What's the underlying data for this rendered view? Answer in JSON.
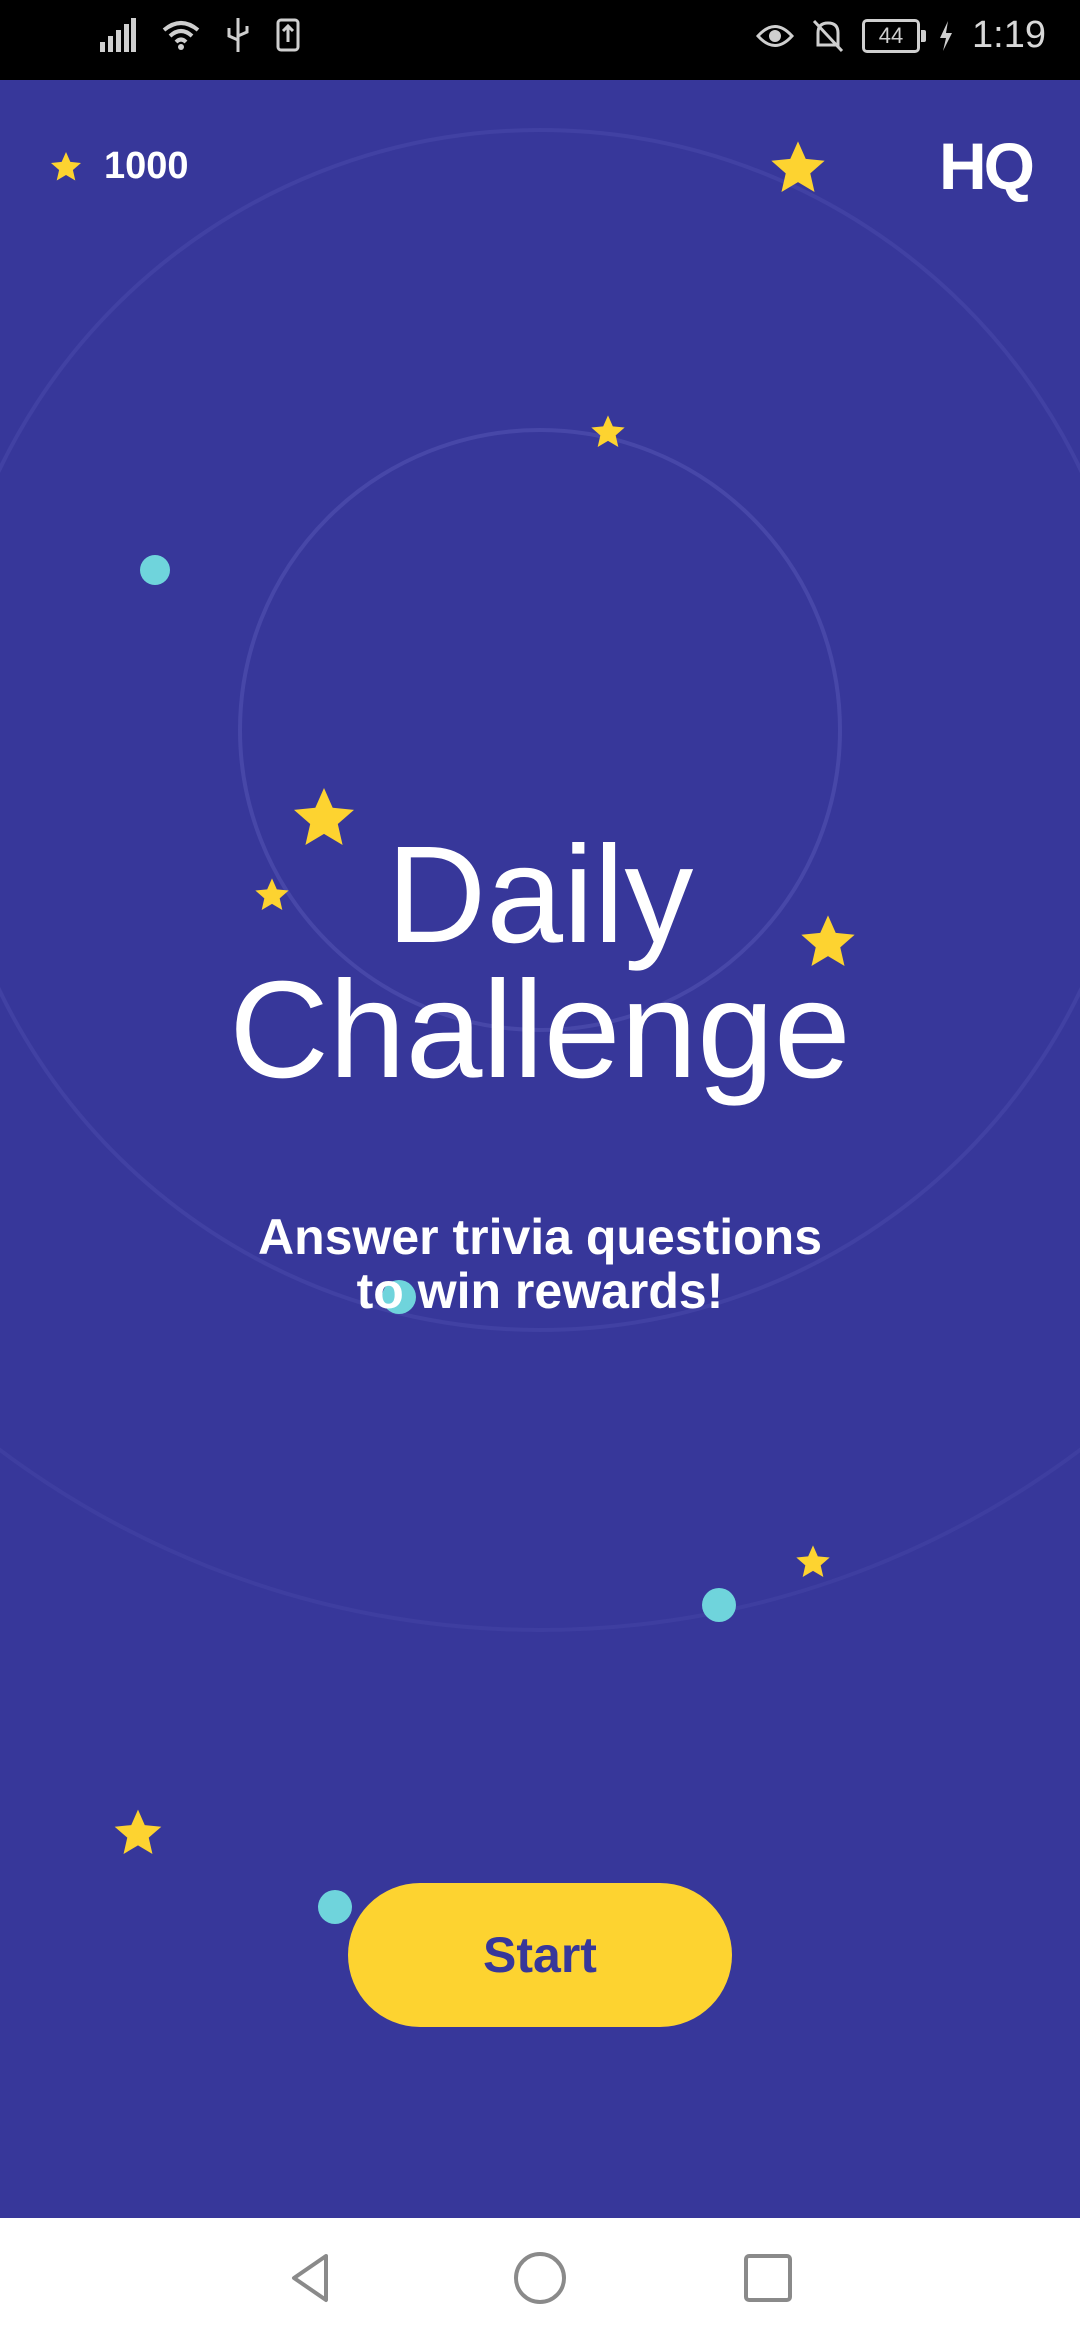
{
  "status_bar": {
    "time": "1:19",
    "battery_level": "44",
    "icons": [
      "signal-icon",
      "wifi-icon",
      "usb-icon",
      "download-icon",
      "eye-icon",
      "mute-icon",
      "battery-icon",
      "charging-icon"
    ]
  },
  "header": {
    "points": "1000",
    "logo": "HQ"
  },
  "main": {
    "title_line1": "Daily",
    "title_line2": "Challenge",
    "subtitle_line1": "Answer trivia questions",
    "subtitle_line2": "to win rewards!",
    "start_label": "Start"
  },
  "colors": {
    "background": "#37379a",
    "accent": "#fdd330",
    "dot": "#6fd4dc"
  },
  "nav": [
    "back-icon",
    "home-icon",
    "recents-icon"
  ]
}
